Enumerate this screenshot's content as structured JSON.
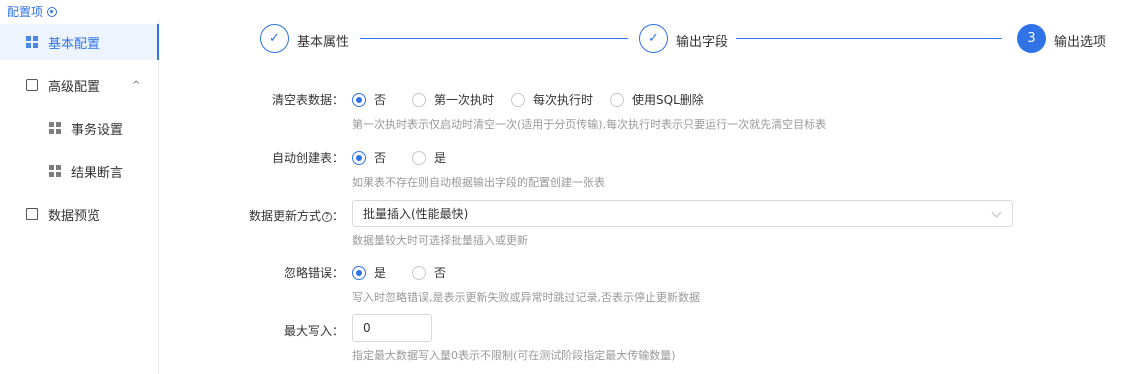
{
  "header": {
    "title": "配置项"
  },
  "sidebar": {
    "items": [
      {
        "label": "基本配置"
      },
      {
        "label": "高级配置",
        "chevron": "^"
      },
      {
        "label": "事务设置"
      },
      {
        "label": "结果断言"
      },
      {
        "label": "数据预览"
      }
    ]
  },
  "steps": [
    {
      "label": "基本属性",
      "state": "done",
      "mark": "✓"
    },
    {
      "label": "输出字段",
      "state": "done",
      "mark": "✓"
    },
    {
      "label": "输出选项",
      "state": "current",
      "mark": "3"
    }
  ],
  "form": {
    "clear_table": {
      "label": "清空表数据：",
      "options": [
        "否",
        "第一次执时",
        "每次执行时",
        "使用SQL删除"
      ],
      "selected": "否",
      "hint": "第一次执时表示仅启动时清空一次(适用于分页传输),每次执行时表示只要运行一次就先清空目标表"
    },
    "auto_create": {
      "label": "自动创建表：",
      "options": [
        "否",
        "是"
      ],
      "selected": "否",
      "hint": "如果表不存在则自动根据输出字段的配置创建一张表"
    },
    "update_mode": {
      "label": "数据更新方式",
      "label_suffix": "：",
      "value": "批量插入(性能最快)",
      "hint": "数据量较大时可选择批量插入或更新"
    },
    "ignore_errors": {
      "label": "忽略错误：",
      "options": [
        "是",
        "否"
      ],
      "selected": "是",
      "hint": "写入时忽略错误,是表示更新失败或异常时跳过记录,否表示停止更新数据"
    },
    "max_write": {
      "label": "最大写入：",
      "value": "0",
      "hint": "指定最大数据写入量0表示不限制(可在测试阶段指定最大传输数量)"
    }
  },
  "colors": {
    "accent": "#2f73e6",
    "hint": "#999999",
    "border": "#d9d9d9"
  }
}
